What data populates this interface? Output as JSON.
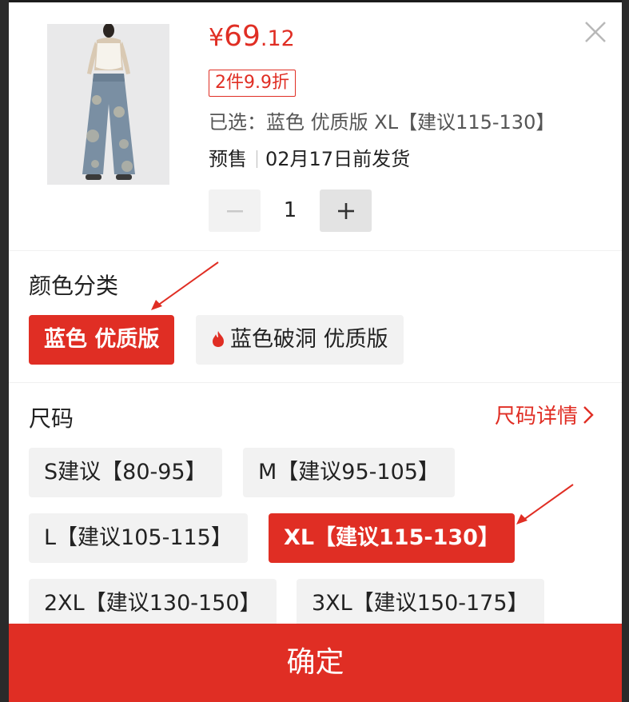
{
  "colors": {
    "accent": "#e02e24",
    "chip_bg": "#f2f2f2",
    "text": "#222222",
    "muted": "#555555"
  },
  "product": {
    "image_alt": "wide-leg denim jeans product photo",
    "price_currency": "¥",
    "price_integer": "69",
    "price_decimal": ".12",
    "promo_badge": "2件9.9折",
    "selected_text": "已选：蓝色 优质版 XL【建议115-130】",
    "presale_label": "预售",
    "ship_date": "02月17日前发货",
    "close_icon": "close-icon"
  },
  "quantity": {
    "value": "1",
    "minus_icon": "minus-icon",
    "plus_icon": "plus-icon",
    "minus_disabled": true
  },
  "color_section": {
    "title": "颜色分类",
    "options": [
      {
        "label": "蓝色 优质版",
        "selected": true
      },
      {
        "label": "蓝色破洞 优质版",
        "selected": false,
        "icon": "flame-icon"
      }
    ]
  },
  "size_section": {
    "title": "尺码",
    "guide_link": "尺码详情",
    "options": [
      {
        "label": "S建议【80-95】",
        "selected": false
      },
      {
        "label": "M【建议95-105】",
        "selected": false
      },
      {
        "label": "L【建议105-115】",
        "selected": false
      },
      {
        "label": "XL【建议115-130】",
        "selected": true
      },
      {
        "label": "2XL【建议130-150】",
        "selected": false
      },
      {
        "label": "3XL【建议150-175】",
        "selected": false
      }
    ]
  },
  "confirm_button": "确定"
}
